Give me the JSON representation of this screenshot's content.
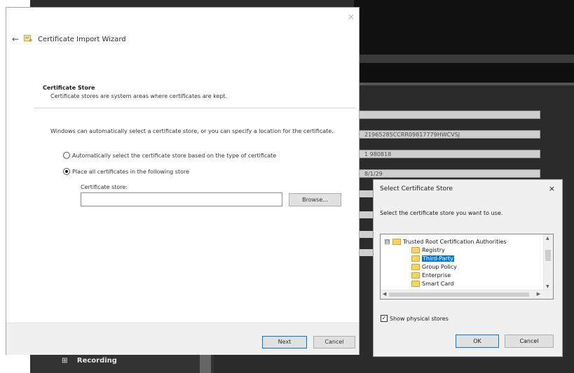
{
  "background_app": {
    "fields": [
      "",
      "21965285CCRR09817779HWCVSJ",
      "1 980818",
      "8/1/29"
    ],
    "recording": {
      "label": "Recording",
      "expander": "⊞"
    }
  },
  "wizard": {
    "close_glyph": "×",
    "back_glyph": "←",
    "title": "Certificate Import Wizard",
    "heading": "Certificate Store",
    "subheading": "Certificate stores are system areas where certificates are kept.",
    "description": "Windows can automatically select a certificate store, or you can specify a location for the certificate.",
    "radio_auto_label": "Automatically select the certificate store based on the type of certificate",
    "radio_auto_checked": false,
    "radio_place_label": "Place all certificates in the following store",
    "radio_place_checked": true,
    "store_label": "Certificate store:",
    "store_value": "",
    "browse_label": "Browse...",
    "next_label": "Next",
    "cancel_label": "Cancel"
  },
  "store_dialog": {
    "title": "Select Certificate Store",
    "close_glyph": "×",
    "instruction": "Select the certificate store you want to use.",
    "tree": {
      "root_expander": "⊟",
      "root": "Trusted Root Certification Authorities",
      "children": [
        "Registry",
        "Third-Party",
        "Group Policy",
        "Enterprise",
        "Smart Card"
      ],
      "selected": "Third-Party"
    },
    "show_physical_label": "Show physical stores",
    "show_physical_checked": true,
    "checkbox_glyph": "✓",
    "ok_label": "OK",
    "cancel_label": "Cancel",
    "scroll_arrows": {
      "up": "▲",
      "down": "▼",
      "left": "◀",
      "right": "▶"
    }
  },
  "colors": {
    "selection": "#0078d7",
    "dark_bg": "#2b2b2b",
    "dialog_bg": "#f0f0f0",
    "folder": "#f6d365"
  },
  "icons": [
    "close-icon",
    "back-arrow-icon",
    "certificate-icon",
    "folder-icon",
    "expander-icon",
    "checkbox-icon"
  ]
}
